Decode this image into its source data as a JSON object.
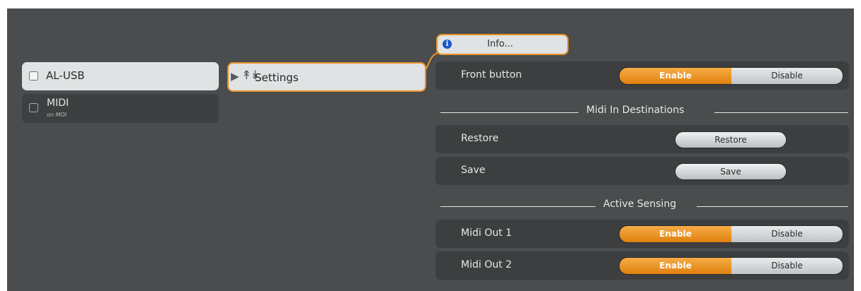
{
  "devices": [
    {
      "label": "AL-USB",
      "sublabel": "",
      "selected": true
    },
    {
      "label": "MIDI",
      "sublabel": "on MOI",
      "selected": false
    }
  ],
  "settings_node": {
    "label": "Settings",
    "arrow_icon": "chevron-right-icon",
    "icon": "sliders-icon"
  },
  "info_node": {
    "label": "Info...",
    "icon": "info-icon"
  },
  "front_button": {
    "label": "Front button",
    "enable": "Enable",
    "disable": "Disable",
    "state": "Enable"
  },
  "midi_in_section": {
    "title": "Midi In Destinations"
  },
  "restore": {
    "label": "Restore",
    "button": "Restore"
  },
  "save": {
    "label": "Save",
    "button": "Save"
  },
  "active_sensing_section": {
    "title": "Active Sensing"
  },
  "midi_out_1": {
    "label": "Midi Out 1",
    "enable": "Enable",
    "disable": "Disable",
    "state": "Enable"
  },
  "midi_out_2": {
    "label": "Midi Out 2",
    "enable": "Enable",
    "disable": "Disable",
    "state": "Enable"
  },
  "colors": {
    "accent": "#e9922b",
    "panel": "#4a4c4d",
    "row": "#3c3e3f",
    "selected": "#dfe3e3",
    "info_icon": "#1f55c9"
  }
}
